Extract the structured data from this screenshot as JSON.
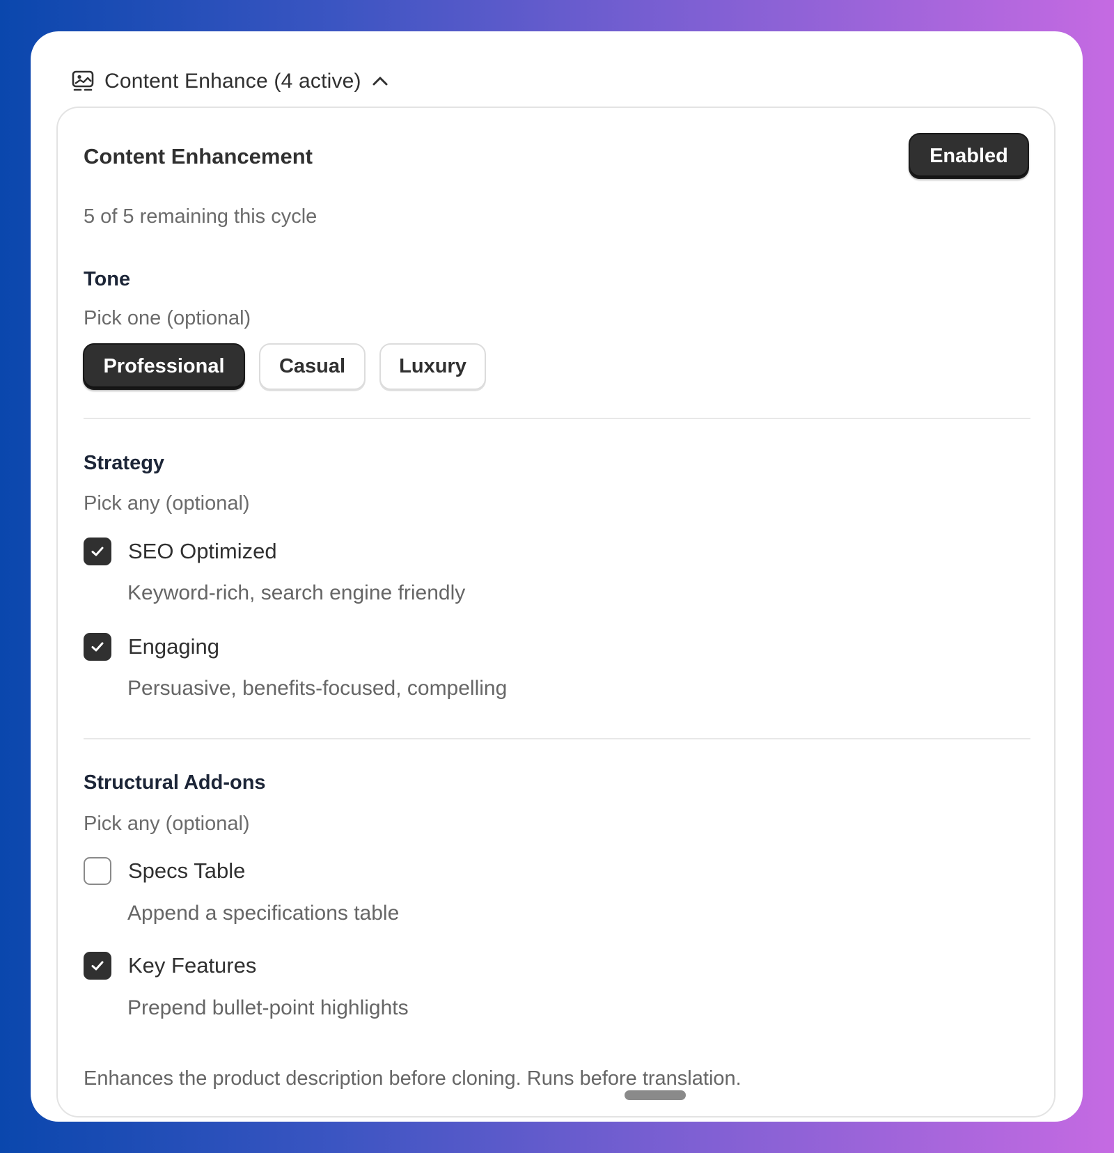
{
  "section": {
    "title": "Content Enhance (4 active)",
    "icon": "image-sparkle-icon",
    "toggle_icon": "chevron-up-icon"
  },
  "card": {
    "title": "Content Enhancement",
    "status_button": "Enabled",
    "remaining": "5 of 5 remaining this cycle"
  },
  "tone": {
    "heading": "Tone",
    "hint": "Pick one (optional)",
    "options": [
      {
        "label": "Professional",
        "selected": true
      },
      {
        "label": "Casual",
        "selected": false
      },
      {
        "label": "Luxury",
        "selected": false
      }
    ]
  },
  "strategy": {
    "heading": "Strategy",
    "hint": "Pick any (optional)",
    "items": [
      {
        "label": "SEO Optimized",
        "description": "Keyword-rich, search engine friendly",
        "checked": true
      },
      {
        "label": "Engaging",
        "description": "Persuasive, benefits-focused, compelling",
        "checked": true
      }
    ]
  },
  "structural": {
    "heading": "Structural Add-ons",
    "hint": "Pick any (optional)",
    "items": [
      {
        "label": "Specs Table",
        "description": "Append a specifications table",
        "checked": false
      },
      {
        "label": "Key Features",
        "description": "Prepend bullet-point highlights",
        "checked": true
      }
    ]
  },
  "footer": {
    "note": "Enhances the product description before cloning. Runs before translation."
  },
  "colors": {
    "primary_dark": "#303030",
    "muted_text": "#6b6b6b",
    "border": "#e3e3e3"
  }
}
